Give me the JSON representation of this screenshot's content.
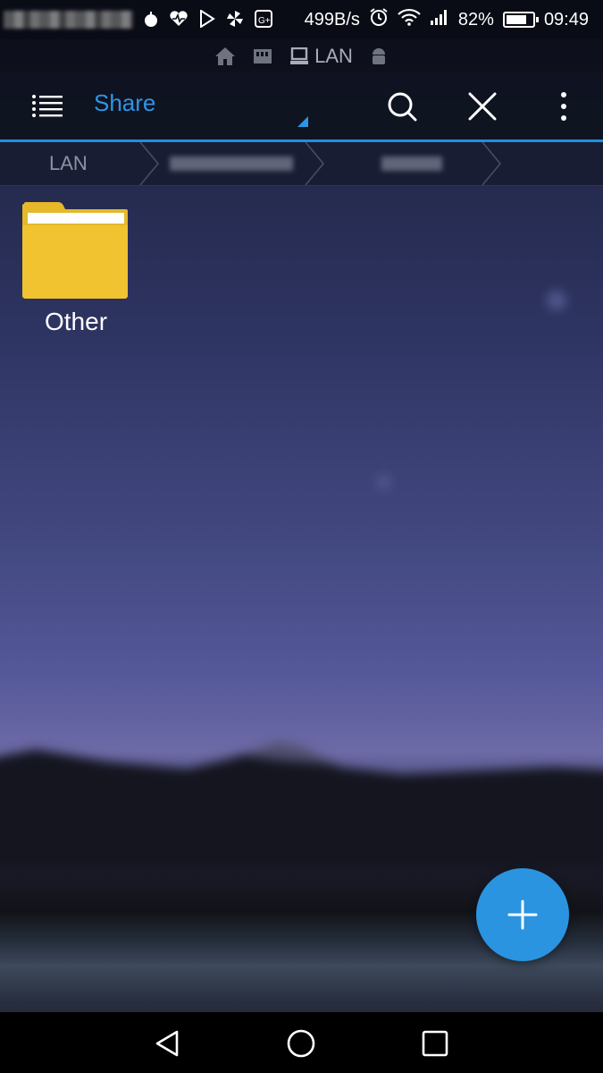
{
  "status_bar": {
    "net_speed": "499B/s",
    "battery_percent": "82%",
    "battery_level": 0.82,
    "time": "09:49",
    "icons": [
      "bomb-icon",
      "health-icon",
      "play-store-icon",
      "pinwheel-icon",
      "google-plus-icon",
      "alarm-icon",
      "wifi-icon",
      "signal-icon",
      "battery-icon"
    ]
  },
  "location_bar": {
    "label": "LAN",
    "icons": [
      "home-icon",
      "sd-card-icon",
      "computer-icon",
      "android-icon"
    ]
  },
  "toolbar": {
    "title": "Share",
    "icons": [
      "menu-icon",
      "search-icon",
      "close-icon",
      "more-vert-icon"
    ]
  },
  "breadcrumb": {
    "items": [
      "LAN"
    ]
  },
  "files": [
    {
      "name": "Other",
      "type": "folder",
      "color": "#f2c330"
    }
  ],
  "fab": {
    "icon": "plus-icon",
    "color": "#2a94e0"
  },
  "nav_bar": {
    "icons": [
      "back-icon",
      "home-circle-icon",
      "recents-icon"
    ]
  },
  "colors": {
    "accent": "#2d95e6",
    "folder": "#f2c330"
  }
}
